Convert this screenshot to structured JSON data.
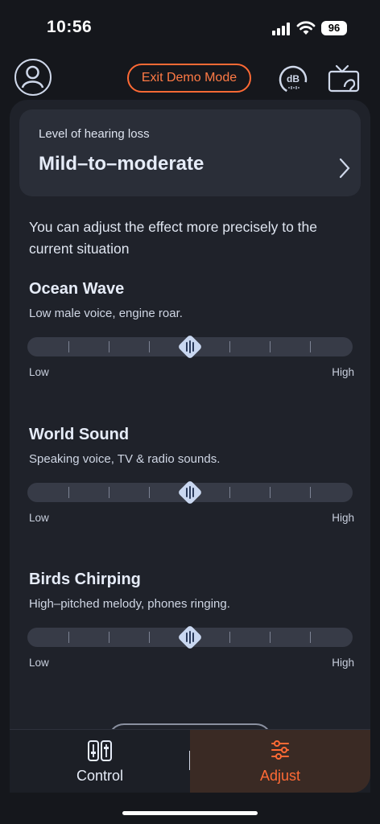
{
  "status_bar": {
    "time": "10:56",
    "battery": "96"
  },
  "header": {
    "demo_button": "Exit Demo Mode",
    "db_icon_text": "dB",
    "accent": "#ff6a35"
  },
  "hearing": {
    "label": "Level of hearing loss",
    "value": "Mild–to–moderate"
  },
  "intro": "You can adjust the effect more precisely to the current situation",
  "sections": [
    {
      "title": "Ocean Wave",
      "desc": "Low male voice, engine roar.",
      "low": "Low",
      "high": "High",
      "level": 0.5
    },
    {
      "title": "World Sound",
      "desc": "Speaking voice, TV & radio sounds.",
      "low": "Low",
      "high": "High",
      "level": 0.5
    },
    {
      "title": "Birds Chirping",
      "desc": "High–pitched melody, phones ringing.",
      "low": "Low",
      "high": "High",
      "level": 0.5
    }
  ],
  "tabs": {
    "control": "Control",
    "adjust": "Adjust"
  }
}
